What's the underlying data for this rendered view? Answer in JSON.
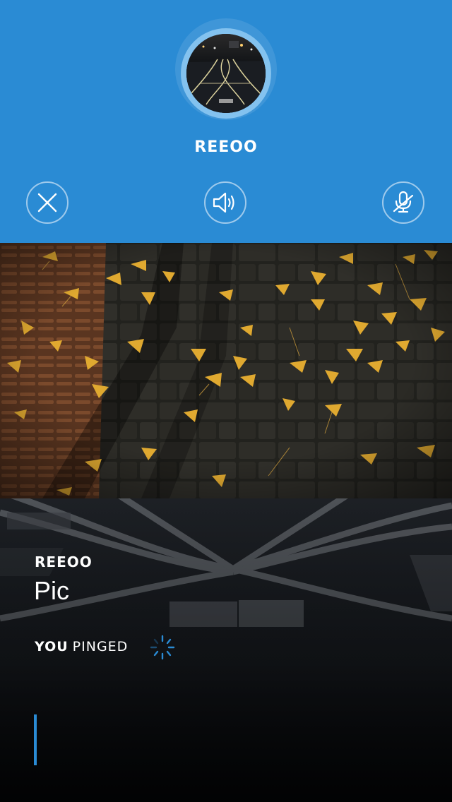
{
  "call": {
    "caller_name": "REEOO",
    "avatar_description_icon": "avatar-photo",
    "controls": {
      "close_icon": "close-icon",
      "speaker_icon": "speaker-icon",
      "mic_icon": "mic-muted-icon"
    }
  },
  "message": {
    "sender": "REEOO",
    "title": "Pic",
    "status_you": "YOU",
    "status_action": "PINGED",
    "spinner_icon": "loading-spinner-icon"
  },
  "colors": {
    "accent": "#2a8bd4",
    "header_bg": "#2a8bd4",
    "text": "#ffffff"
  }
}
